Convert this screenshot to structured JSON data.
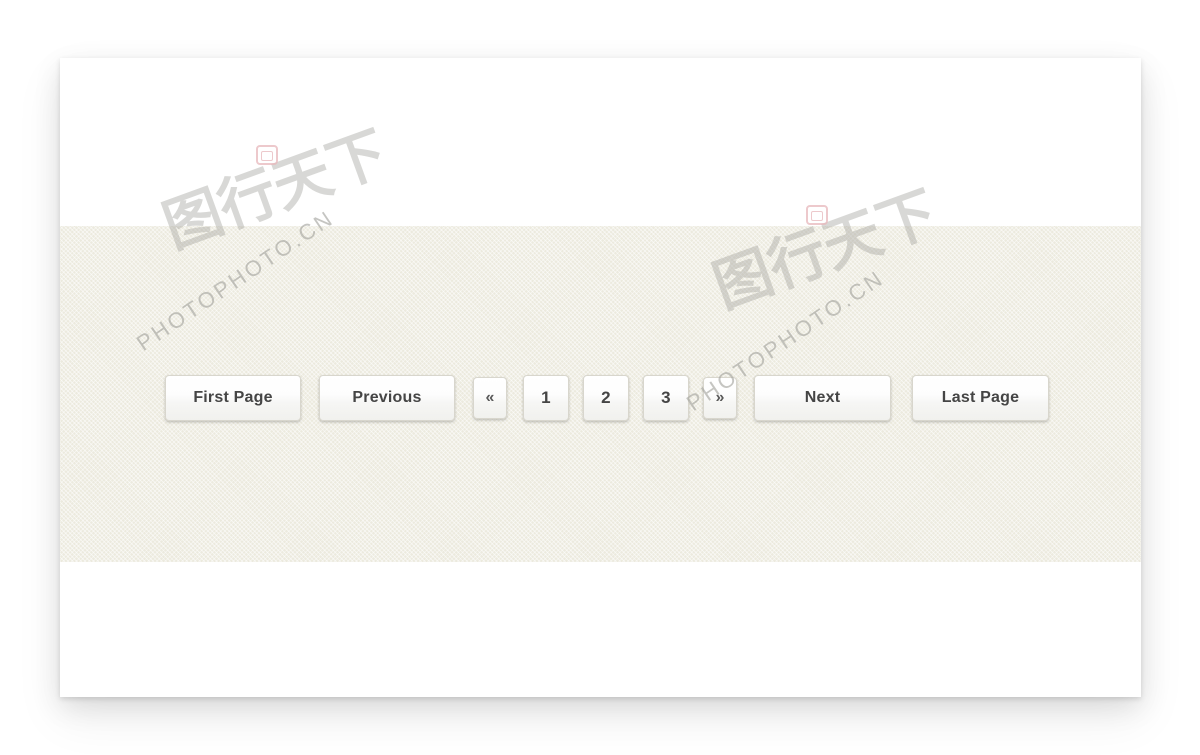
{
  "page": {
    "background_color": "#ffffff",
    "card_background": "#ffffff",
    "band_color": "#eceade",
    "button_text_color": "#454545",
    "button_border_color": "#d8d6cd"
  },
  "pagination": {
    "first_page_label": "First Page",
    "previous_label": "Previous",
    "prev_chevron": "«",
    "next_chevron": "»",
    "next_label": "Next",
    "last_page_label": "Last Page",
    "pages": [
      {
        "label": "1"
      },
      {
        "label": "2"
      },
      {
        "label": "3"
      }
    ]
  },
  "watermarks": [
    {
      "cjk": "图行天下",
      "latin": "PHOTOPHOTO.CN",
      "seal": "seal-stamp"
    },
    {
      "cjk": "图行天下",
      "latin": "PHOTOPHOTO.CN",
      "seal": "seal-stamp"
    }
  ]
}
